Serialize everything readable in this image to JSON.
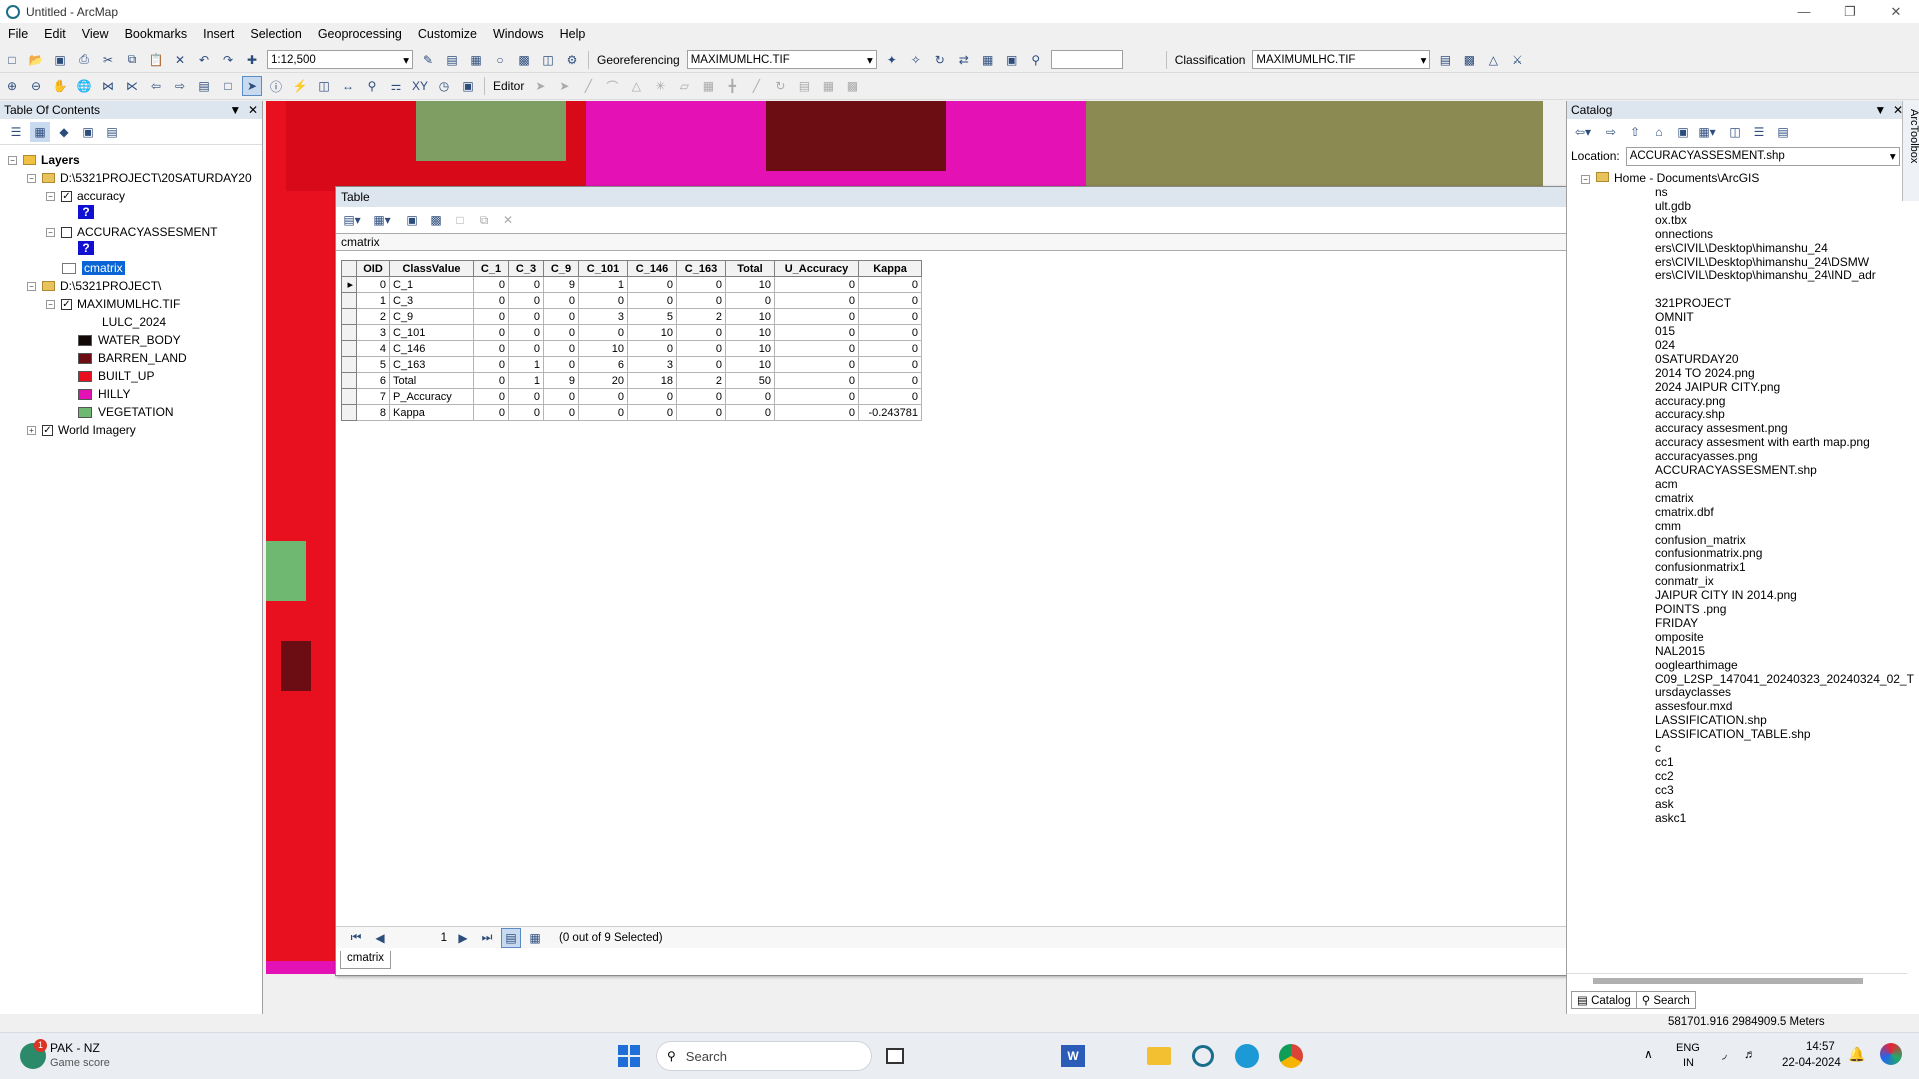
{
  "window": {
    "title": "Untitled - ArcMap"
  },
  "menu": [
    "File",
    "Edit",
    "View",
    "Bookmarks",
    "Insert",
    "Selection",
    "Geoprocessing",
    "Customize",
    "Windows",
    "Help"
  ],
  "toolbar": {
    "scale": "1:12,500",
    "georeferencing_label": "Georeferencing",
    "georef_layer": "MAXIMUMLHC.TIF",
    "classification_label": "Classification",
    "class_layer": "MAXIMUMLHC.TIF",
    "editor_label": "Editor"
  },
  "toc": {
    "title": "Table Of Contents",
    "layers_label": "Layers",
    "group1": "D:\\5321PROJECT\\20SATURDAY20",
    "layer_accuracy": "accuracy",
    "layer_accass": "ACCURACYASSESMENT",
    "layer_cmatrix": "cmatrix",
    "group2": "D:\\5321PROJECT\\",
    "layer_tif": "MAXIMUMLHC.TIF",
    "legend_heading": "LULC_2024",
    "legend": [
      {
        "label": "WATER_BODY",
        "color": "#120808"
      },
      {
        "label": "BARREN_LAND",
        "color": "#6b0d12"
      },
      {
        "label": "BUILT_UP",
        "color": "#e8101e"
      },
      {
        "label": "HILLY",
        "color": "#e412b4"
      },
      {
        "label": "VEGETATION",
        "color": "#6fb872"
      }
    ],
    "world_imagery": "World Imagery"
  },
  "table_window": {
    "title": "Table",
    "tab_name": "cmatrix",
    "columns": [
      "OID",
      "ClassValue",
      "C_1",
      "C_3",
      "C_9",
      "C_101",
      "C_146",
      "C_163",
      "Total",
      "U_Accuracy",
      "Kappa"
    ],
    "rows": [
      [
        "0",
        "C_1",
        "0",
        "0",
        "9",
        "1",
        "0",
        "0",
        "10",
        "0",
        "0"
      ],
      [
        "1",
        "C_3",
        "0",
        "0",
        "0",
        "0",
        "0",
        "0",
        "0",
        "0",
        "0"
      ],
      [
        "2",
        "C_9",
        "0",
        "0",
        "0",
        "3",
        "5",
        "2",
        "10",
        "0",
        "0"
      ],
      [
        "3",
        "C_101",
        "0",
        "0",
        "0",
        "0",
        "10",
        "0",
        "10",
        "0",
        "0"
      ],
      [
        "4",
        "C_146",
        "0",
        "0",
        "0",
        "10",
        "0",
        "0",
        "10",
        "0",
        "0"
      ],
      [
        "5",
        "C_163",
        "0",
        "1",
        "0",
        "6",
        "3",
        "0",
        "10",
        "0",
        "0"
      ],
      [
        "6",
        "Total",
        "0",
        "1",
        "9",
        "20",
        "18",
        "2",
        "50",
        "0",
        "0"
      ],
      [
        "7",
        "P_Accuracy",
        "0",
        "0",
        "0",
        "0",
        "0",
        "0",
        "0",
        "0",
        "0"
      ],
      [
        "8",
        "Kappa",
        "0",
        "0",
        "0",
        "0",
        "0",
        "0",
        "0",
        "0",
        "-0.243781"
      ]
    ],
    "page": "1",
    "selection_status": "(0 out of 9 Selected)",
    "bottom_tab": "cmatrix"
  },
  "catalog": {
    "title": "Catalog",
    "location_label": "Location:",
    "location_value": "ACCURACYASSESMENT.shp",
    "home": "Home - Documents\\ArcGIS",
    "items": [
      "ns",
      "ult.gdb",
      "ox.tbx",
      "onnections",
      "ers\\CIVIL\\Desktop\\himanshu_24",
      "ers\\CIVIL\\Desktop\\himanshu_24\\DSMW",
      "ers\\CIVIL\\Desktop\\himanshu_24\\IND_adr",
      "",
      "321PROJECT",
      "OMNIT",
      "015",
      "024",
      "0SATURDAY20",
      "2014 TO 2024.png",
      "2024 JAIPUR CITY.png",
      "accuracy.png",
      "accuracy.shp",
      "accuracy assesment.png",
      "accuracy assesment with earth map.png",
      "accuracyasses.png",
      "ACCURACYASSESMENT.shp",
      "acm",
      "cmatrix",
      "cmatrix.dbf",
      "cmm",
      "confusion_matrix",
      "confusionmatrix.png",
      "confusionmatrix1",
      "conmatr_ix",
      "JAIPUR CITY IN 2014.png",
      "POINTS .png",
      "FRIDAY",
      "omposite",
      "NAL2015",
      "ooglearthimage",
      "C09_L2SP_147041_20240323_20240324_02_T",
      "ursdayclasses",
      "assesfour.mxd",
      "LASSIFICATION.shp",
      "LASSIFICATION_TABLE.shp",
      "c",
      "cc1",
      "cc2",
      "cc3",
      "ask",
      "askc1"
    ],
    "tab_catalog": "Catalog",
    "tab_search": "Search",
    "toolbox_tab": "ArcToolbox"
  },
  "status": {
    "coords": "581701.916  2984909.5 Meters"
  },
  "taskbar": {
    "weather_title": "PAK - NZ",
    "weather_sub": "Game score",
    "badge": "1",
    "search": "Search",
    "lang1": "ENG",
    "lang2": "IN",
    "time": "14:57",
    "date": "22-04-2024"
  }
}
